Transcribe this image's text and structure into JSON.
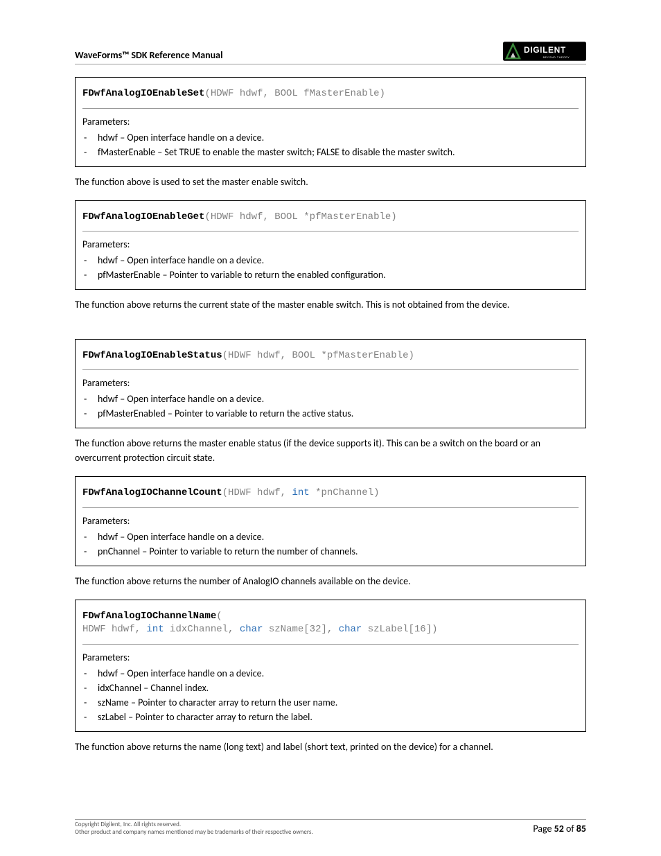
{
  "header": {
    "title": "WaveForms™ SDK Reference Manual",
    "logo_brand": "DIGILENT",
    "logo_tagline": "BEYOND THEORY"
  },
  "functions": [
    {
      "name": "FDwfAnalogIOEnableSet",
      "sig_prefix": "(HDWF hdwf, BOOL fMasterEnable)",
      "params_label": "Parameters:",
      "params": [
        "hdwf – Open interface handle on a device.",
        "fMasterEnable – Set TRUE to enable the master switch; FALSE to disable the master switch."
      ],
      "desc": "The function above is used to set the master enable switch."
    },
    {
      "name": "FDwfAnalogIOEnableGet",
      "sig_prefix": "(HDWF hdwf, BOOL *pfMasterEnable)",
      "params_label": "Parameters:",
      "params": [
        "hdwf – Open interface handle on a device.",
        "pfMasterEnable – Pointer to variable to return the enabled configuration."
      ],
      "desc": "The function above returns the current state of the master enable switch. This is not obtained from the device."
    },
    {
      "name": "FDwfAnalogIOEnableStatus",
      "sig_prefix": "(HDWF hdwf, BOOL *pfMasterEnable)",
      "params_label": "Parameters:",
      "params": [
        "hdwf – Open interface handle on a device.",
        "pfMasterEnabled – Pointer to variable to return the active status."
      ],
      "desc": "The function above returns the master enable status (if the device supports it). This can be a switch on the board or an overcurrent protection circuit state."
    },
    {
      "name": "FDwfAnalogIOChannelCount",
      "sig_pre": "(HDWF hdwf, ",
      "sig_kw1": "int",
      "sig_post": " *pnChannel)",
      "params_label": "Parameters:",
      "params": [
        "hdwf – Open interface handle on a device.",
        "pnChannel – Pointer to variable to return the number of channels."
      ],
      "desc": "The function above returns the number of AnalogIO channels available on the device."
    },
    {
      "name": "FDwfAnalogIOChannelName",
      "multiline": true,
      "line2_pre": "HDWF hdwf, ",
      "line2_kw1": "int",
      "line2_mid1": " idxChannel, ",
      "line2_kw2": "char",
      "line2_mid2": " szName[32], ",
      "line2_kw3": "char",
      "line2_post": " szLabel[16])",
      "params_label": "Parameters:",
      "params": [
        "hdwf – Open interface handle on a device.",
        "idxChannel – Channel index.",
        "szName – Pointer to character array to return the user name.",
        "szLabel – Pointer to character array to return the label."
      ],
      "desc": "The function above returns the name (long text) and label (short text, printed on the device) for a channel."
    }
  ],
  "footer": {
    "copyright": "Copyright Digilent, Inc. All rights reserved.",
    "trademark": "Other product and company names mentioned may be trademarks of their respective owners.",
    "page_label_pre": "Page ",
    "page_current": "52",
    "page_label_mid": " of ",
    "page_total": "85"
  }
}
